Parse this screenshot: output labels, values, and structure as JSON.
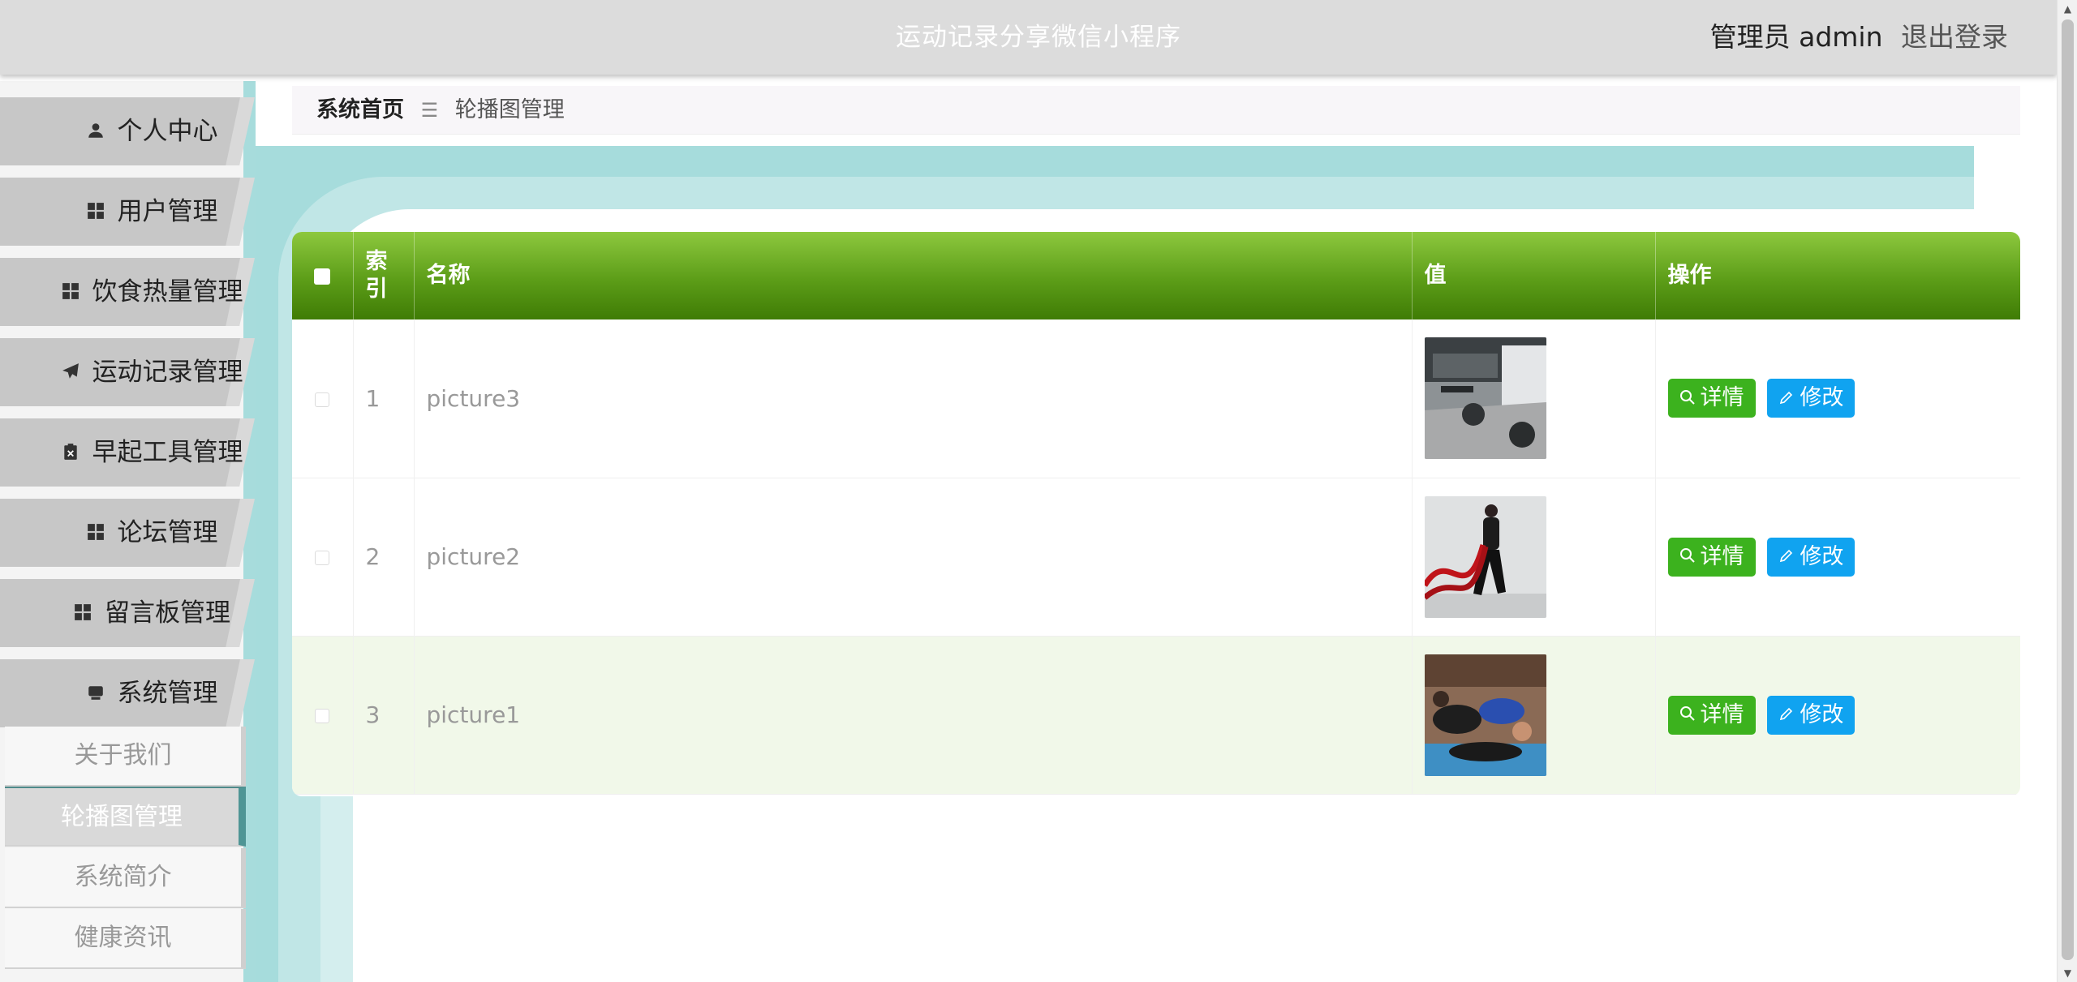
{
  "header": {
    "app_title": "运动记录分享微信小程序",
    "user_label": "管理员 admin",
    "logout_label": "退出登录"
  },
  "sidebar": {
    "menu": [
      {
        "label": "个人中心",
        "icon": "user-icon"
      },
      {
        "label": "用户管理",
        "icon": "grid-icon"
      },
      {
        "label": "饮食热量管理",
        "icon": "grid-icon"
      },
      {
        "label": "运动记录管理",
        "icon": "paper-plane-icon"
      },
      {
        "label": "早起工具管理",
        "icon": "clipboard-icon"
      },
      {
        "label": "论坛管理",
        "icon": "grid-icon"
      },
      {
        "label": "留言板管理",
        "icon": "grid-icon"
      },
      {
        "label": "系统管理",
        "icon": "monitor-icon"
      }
    ],
    "submenu": [
      {
        "label": "关于我们",
        "active": false
      },
      {
        "label": "轮播图管理",
        "active": true
      },
      {
        "label": "系统简介",
        "active": false
      },
      {
        "label": "健康资讯",
        "active": false
      }
    ]
  },
  "breadcrumb": {
    "home": "系统首页",
    "separator": "☰",
    "current": "轮播图管理"
  },
  "table": {
    "headers": {
      "index": "索引",
      "name": "名称",
      "value": "值",
      "ops": "操作"
    },
    "rows": [
      {
        "index": "1",
        "name": "picture3",
        "image": "gym-interior-photo"
      },
      {
        "index": "2",
        "name": "picture2",
        "image": "battle-rope-photo"
      },
      {
        "index": "3",
        "name": "picture1",
        "image": "group-exercise-photo"
      }
    ],
    "actions": {
      "detail_label": "详情",
      "edit_label": "修改"
    }
  },
  "colors": {
    "header_bg": "#dcdcdc",
    "table_header": "#5c9d18",
    "detail_button": "#3cb21e",
    "edit_button": "#10a3f0",
    "sidebar_accent": "#a7dcdc",
    "active_submenu_border": "#4f9595"
  }
}
